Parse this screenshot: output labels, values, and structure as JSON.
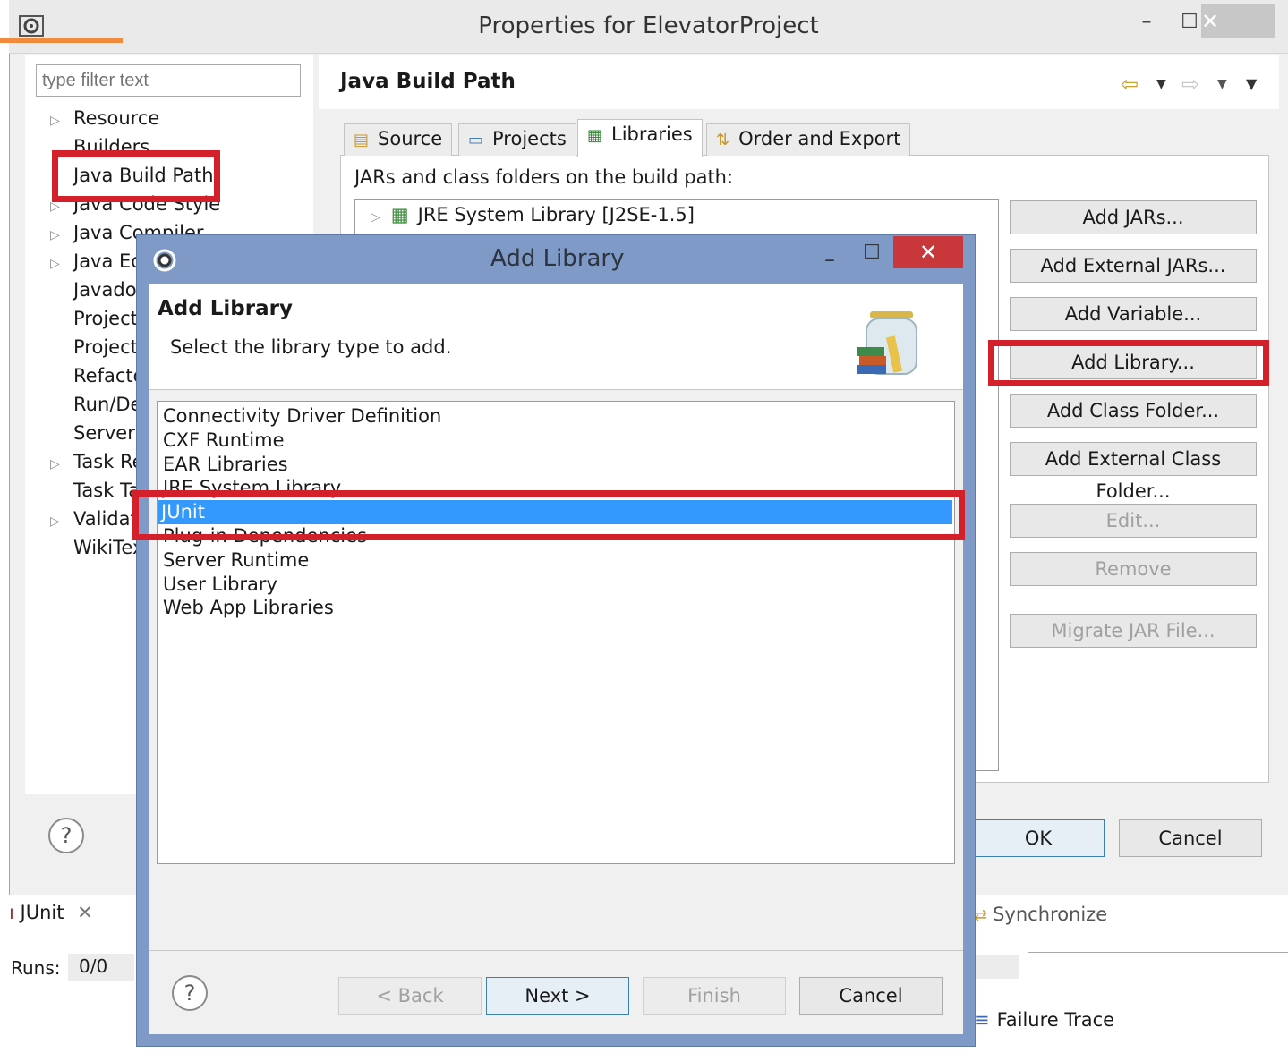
{
  "outer_window": {
    "title": "Properties for ElevatorProject",
    "min_glyph": "–",
    "max_glyph": "☐",
    "close_glyph": "✕"
  },
  "nav": {
    "filter_placeholder": "type filter text",
    "items": [
      {
        "label": "Resource",
        "expandable": true
      },
      {
        "label": "Builders",
        "expandable": false
      },
      {
        "label": "Java Build Path",
        "expandable": false
      },
      {
        "label": "Java Code Style",
        "expandable": true
      },
      {
        "label": "Java Compiler",
        "expandable": true
      },
      {
        "label": "Java Ed",
        "expandable": true
      },
      {
        "label": "Javado",
        "expandable": false
      },
      {
        "label": "Project",
        "expandable": false
      },
      {
        "label": "Project",
        "expandable": false
      },
      {
        "label": "Refacto",
        "expandable": false
      },
      {
        "label": "Run/De",
        "expandable": false
      },
      {
        "label": "Server",
        "expandable": false
      },
      {
        "label": "Task Re",
        "expandable": true
      },
      {
        "label": "Task Ta",
        "expandable": false
      },
      {
        "label": "Validat",
        "expandable": true
      },
      {
        "label": "WikiTex",
        "expandable": false
      }
    ],
    "help_glyph": "?"
  },
  "page": {
    "title": "Java Build Path",
    "tabs": [
      {
        "label": "Source",
        "icon": "source-folder-icon"
      },
      {
        "label": "Projects",
        "icon": "projects-folder-icon"
      },
      {
        "label": "Libraries",
        "icon": "libraries-icon"
      },
      {
        "label": "Order and Export",
        "icon": "order-export-icon"
      }
    ],
    "build_path_label": "JARs and class folders on the build path:",
    "tree_entry": "JRE System Library [J2SE-1.5]",
    "buttons": [
      {
        "label": "Add JARs...",
        "enabled": true
      },
      {
        "label": "Add External JARs...",
        "enabled": true
      },
      {
        "label": "Add Variable...",
        "enabled": true
      },
      {
        "label": "Add Library...",
        "enabled": true
      },
      {
        "label": "Add Class Folder...",
        "enabled": true
      },
      {
        "label": "Add External Class Folder...",
        "enabled": true
      },
      {
        "label": "Edit...",
        "enabled": false
      },
      {
        "label": "Remove",
        "enabled": false
      },
      {
        "label": "Migrate JAR File...",
        "enabled": false
      }
    ],
    "ok_label": "OK",
    "cancel_label": "Cancel"
  },
  "bottom": {
    "junit_tab": "JUnit",
    "runs_label": "Runs:",
    "runs_value": "0/0",
    "synchronize": "Synchronize",
    "failure_trace": "Failure Trace"
  },
  "dialog": {
    "title": "Add Library",
    "heading": "Add Library",
    "description": "Select the library type to add.",
    "library_types": [
      "Connectivity Driver Definition",
      "CXF Runtime",
      "EAR Libraries",
      "JRE System Library",
      "JUnit",
      "Plug-in Dependencies",
      "Server Runtime",
      "User Library",
      "Web App Libraries"
    ],
    "selected": "JUnit",
    "buttons": {
      "back": "< Back",
      "next": "Next >",
      "finish": "Finish",
      "cancel": "Cancel"
    },
    "help_glyph": "?"
  },
  "colors": {
    "selection": "#3399ff",
    "highlight_box": "#d3202a",
    "dialog_frame": "#7f9ac6",
    "close_button": "#c8383a"
  }
}
